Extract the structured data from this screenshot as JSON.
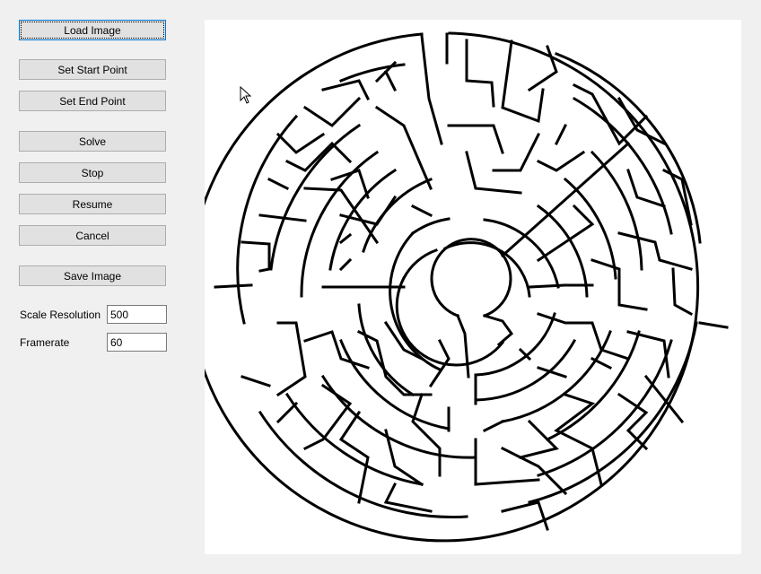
{
  "buttons": {
    "load_image": "Load Image",
    "set_start": "Set Start Point",
    "set_end": "Set End Point",
    "solve": "Solve",
    "stop": "Stop",
    "resume": "Resume",
    "cancel": "Cancel",
    "save_image": "Save Image"
  },
  "settings": {
    "scale_resolution_label": "Scale Resolution",
    "scale_resolution_value": "500",
    "framerate_label": "Framerate",
    "framerate_value": "60"
  },
  "colors": {
    "maze_wall": "#000000",
    "canvas_bg": "#ffffff",
    "window_bg": "#f0f0f0"
  },
  "icons": {
    "cursor": "mouse-pointer-icon"
  }
}
